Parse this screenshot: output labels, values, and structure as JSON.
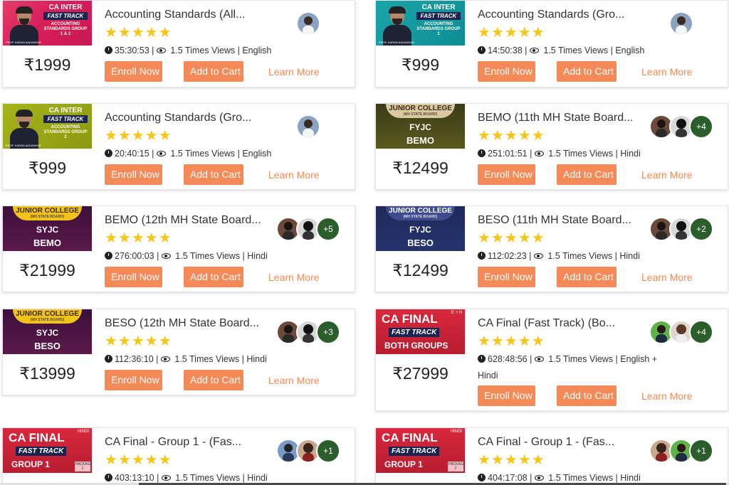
{
  "colors": {
    "accent": "#f38a57",
    "star": "#f5c518"
  },
  "stars": "★★★★★",
  "buttons": {
    "enroll": "Enroll Now",
    "cart": "Add to Cart",
    "learn": "Learn More"
  },
  "cards": [
    {
      "title": "Accounting Standards (All...",
      "price": "₹1999",
      "duration": "35:30:53",
      "views": "1.5 Times Views",
      "language": "English",
      "thumb": {
        "l1": "CA INTER",
        "l2": "FAST TRACK",
        "l3": "ACCOUNTING STANDARDS GROUP 1 & 2",
        "prof": "PROF. KARAN AAGANKAR"
      }
    },
    {
      "title": "Accounting Standards (Gro...",
      "price": "₹999",
      "duration": "14:50:38",
      "views": "1.5 Times Views",
      "language": "English",
      "thumb": {
        "l1": "CA INTER",
        "l2": "FAST TRACK",
        "l3": "ACCOUNTING STANDARDS GROUP 1",
        "prof": "PROF. KARAN AAGANKAR"
      }
    },
    {
      "title": "Accounting Standards (Gro...",
      "price": "₹999",
      "duration": "20:40:15",
      "views": "1.5 Times Views",
      "language": "English",
      "thumb": {
        "l1": "CA INTER",
        "l2": "FAST TRACK",
        "l3": "ACCOUNTING STANDARDS GROUP 2",
        "prof": "PROF. KARAN AAGANKAR"
      }
    },
    {
      "title": "BEMO (11th MH State Board...",
      "price": "₹12499",
      "duration": "251:01:51",
      "views": "1.5 Times Views",
      "language": "Hindi",
      "more": "+4",
      "thumb": {
        "band": "JUNIOR COLLEGE",
        "band_sub": "(MH STATE BOARD)",
        "t1": "FYJC",
        "t2": "BEMO"
      }
    },
    {
      "title": "BEMO (12th MH State Board...",
      "price": "₹21999",
      "duration": "276:00:03",
      "views": "1.5 Times Views",
      "language": "Hindi",
      "more": "+5",
      "thumb": {
        "band": "JUNIOR COLLEGE",
        "band_sub": "(MH STATE BOARD)",
        "t1": "SYJC",
        "t2": "BEMO"
      }
    },
    {
      "title": "BESO (11th MH State Board...",
      "price": "₹12499",
      "duration": "112:02:23",
      "views": "1.5 Times Views",
      "language": "Hindi",
      "more": "+2",
      "thumb": {
        "band": "JUNIOR COLLEGE",
        "band_sub": "(MH STATE BOARD)",
        "t1": "FYJC",
        "t2": "BESO"
      }
    },
    {
      "title": "BESO (12th MH State Board...",
      "price": "₹13999",
      "duration": "112:36:10",
      "views": "1.5 Times Views",
      "language": "Hindi",
      "more": "+3",
      "thumb": {
        "band": "JUNIOR COLLEGE",
        "band_sub": "(MH STATE BOARD)",
        "t1": "SYJC",
        "t2": "BESO"
      }
    },
    {
      "title": "CA Final (Fast Track) (Bo...",
      "price": "₹27999",
      "duration": "628:48:56",
      "views": "1.5 Times Views",
      "language": "English +",
      "language2": "Hindi",
      "more": "+4",
      "thumb": {
        "t1": "CA FINAL",
        "t2": "FAST TRACK",
        "t3": "BOTH GROUPS",
        "tag": "E + H"
      }
    },
    {
      "title": "CA Final - Group 1 - (Fas...",
      "duration": "403:13:10",
      "views": "1.5 Times Views",
      "language": "Hindi",
      "more": "+1",
      "thumb": {
        "t1": "CA FINAL",
        "t2": "FAST TRACK",
        "t3": "GROUP 1",
        "tag": "HINDI",
        "pkg": "PACKAGE 1"
      }
    },
    {
      "title": "CA Final - Group 1 - (Fas...",
      "duration": "404:17:08",
      "views": "1.5 Times Views",
      "language": "Hindi",
      "more": "+1",
      "thumb": {
        "t1": "CA FINAL",
        "t2": "FAST TRACK",
        "t3": "GROUP 1",
        "tag": "HINDI",
        "pkg": "PACKAGE 2"
      }
    }
  ]
}
